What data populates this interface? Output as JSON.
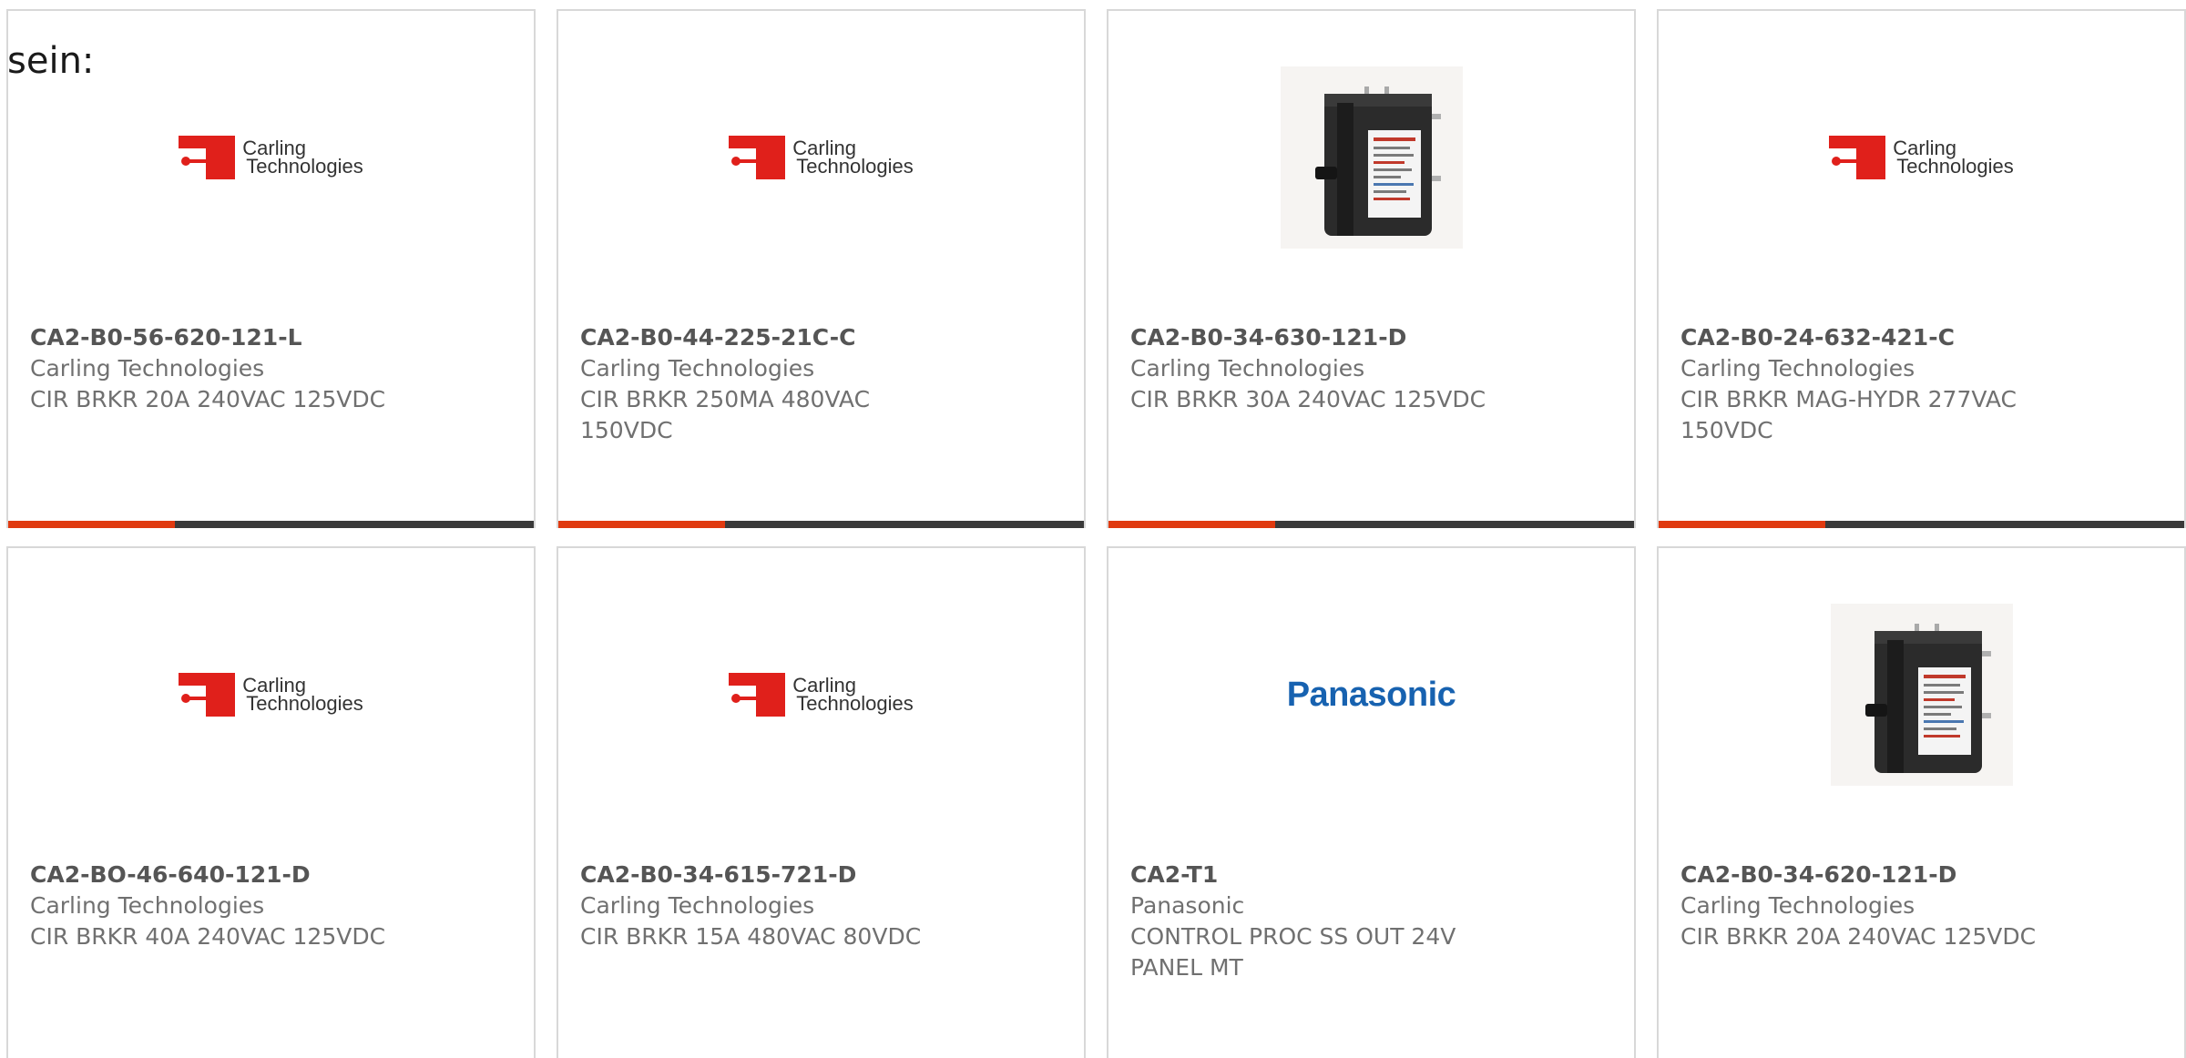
{
  "intro_text": "sein:",
  "products": [
    {
      "part_number": "CA2-B0-56-620-121-L",
      "manufacturer": "Carling Technologies",
      "description": "CIR BRKR 20A 240VAC 125VDC",
      "image": "carling-logo",
      "logo_line1": "Carling",
      "logo_line2": "Technologies"
    },
    {
      "part_number": "CA2-B0-44-225-21C-C",
      "manufacturer": "Carling Technologies",
      "description": "CIR BRKR 250MA 480VAC 150VDC",
      "image": "carling-logo",
      "logo_line1": "Carling",
      "logo_line2": "Technologies"
    },
    {
      "part_number": "CA2-B0-34-630-121-D",
      "manufacturer": "Carling Technologies",
      "description": "CIR BRKR 30A 240VAC 125VDC",
      "image": "circuit-breaker-photo"
    },
    {
      "part_number": "CA2-B0-24-632-421-C",
      "manufacturer": "Carling Technologies",
      "description": "CIR BRKR MAG-HYDR 277VAC 150VDC",
      "image": "carling-logo",
      "logo_line1": "Carling",
      "logo_line2": "Technologies"
    },
    {
      "part_number": "CA2-BO-46-640-121-D",
      "manufacturer": "Carling Technologies",
      "description": "CIR BRKR 40A 240VAC 125VDC",
      "image": "carling-logo",
      "logo_line1": "Carling",
      "logo_line2": "Technologies"
    },
    {
      "part_number": "CA2-B0-34-615-721-D",
      "manufacturer": "Carling Technologies",
      "description": "CIR BRKR 15A 480VAC 80VDC",
      "image": "carling-logo",
      "logo_line1": "Carling",
      "logo_line2": "Technologies"
    },
    {
      "part_number": "CA2-T1",
      "manufacturer": "Panasonic",
      "description": "CONTROL PROC SS OUT 24V PANEL MT",
      "image": "panasonic-logo",
      "logo_text": "Panasonic"
    },
    {
      "part_number": "CA2-B0-34-620-121-D",
      "manufacturer": "Carling Technologies",
      "description": "CIR BRKR 20A 240VAC 125VDC",
      "image": "circuit-breaker-photo"
    }
  ],
  "colors": {
    "accent": "#e03a10",
    "bar": "#3a3a3a",
    "border": "#d8d8d8",
    "text": "#707070",
    "carling_red": "#e0201b",
    "panasonic_blue": "#1762b0"
  }
}
